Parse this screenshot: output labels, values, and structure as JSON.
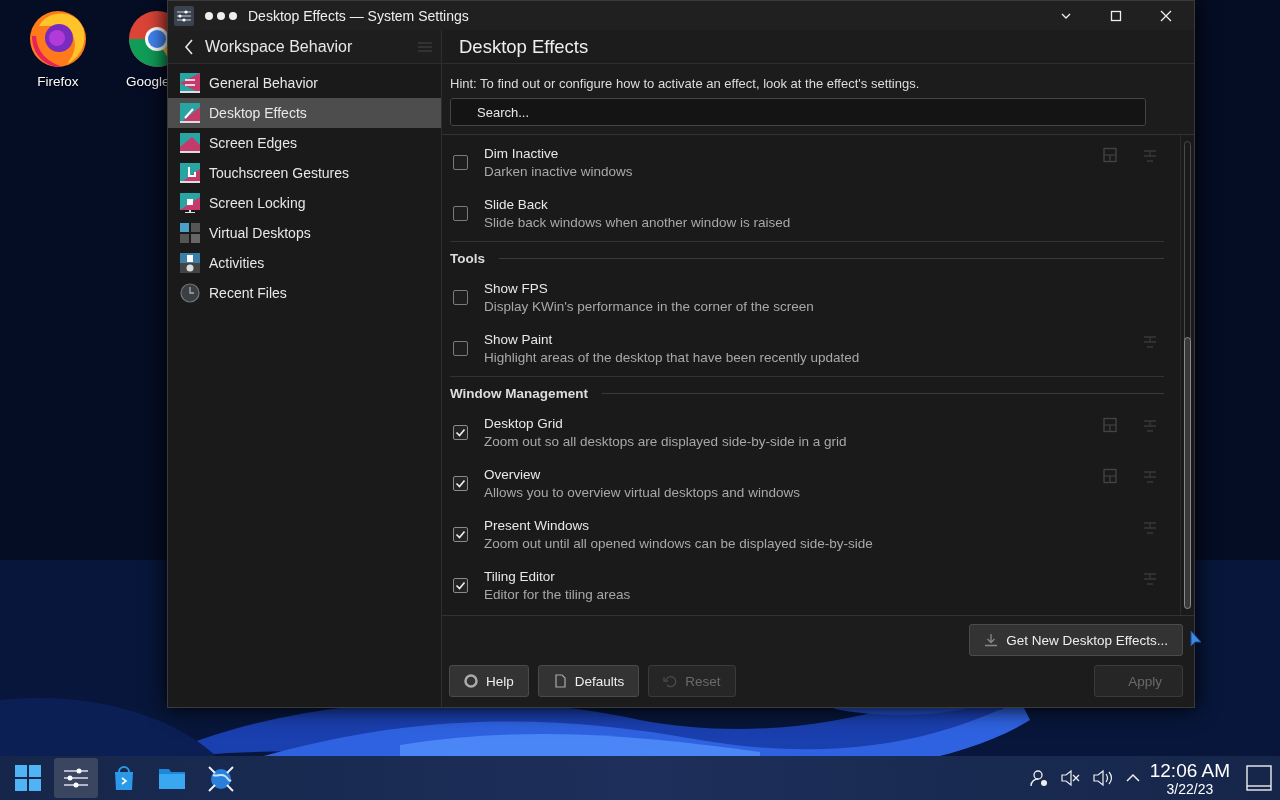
{
  "desktop_icons": [
    {
      "label": "Firefox",
      "kind": "firefox"
    },
    {
      "label": "Google",
      "kind": "chrome"
    }
  ],
  "window": {
    "title": "Desktop Effects — System Settings"
  },
  "sidebar": {
    "title": "Workspace Behavior",
    "items": [
      {
        "label": "General Behavior",
        "kind": "general",
        "selected": false
      },
      {
        "label": "Desktop Effects",
        "kind": "effects",
        "selected": true
      },
      {
        "label": "Screen Edges",
        "kind": "edges",
        "selected": false
      },
      {
        "label": "Touchscreen Gestures",
        "kind": "touch",
        "selected": false
      },
      {
        "label": "Screen Locking",
        "kind": "lock",
        "selected": false
      },
      {
        "label": "Virtual Desktops",
        "kind": "virtual",
        "selected": false
      },
      {
        "label": "Activities",
        "kind": "activities",
        "selected": false
      },
      {
        "label": "Recent Files",
        "kind": "recent",
        "selected": false
      }
    ]
  },
  "content": {
    "title": "Desktop Effects",
    "hint": "Hint: To find out or configure how to activate an effect, look at the effect's settings.",
    "search": {
      "placeholder": "Search..."
    },
    "sections": [
      {
        "effects": [
          {
            "name": "Dim Inactive",
            "description": "Darken inactive windows",
            "checked": false,
            "configurable": true,
            "video": true
          },
          {
            "name": "Slide Back",
            "description": "Slide back windows when another window is raised",
            "checked": false,
            "configurable": false,
            "video": false
          }
        ]
      },
      {
        "heading": "Tools",
        "effects": [
          {
            "name": "Show FPS",
            "description": "Display KWin's performance in the corner of the screen",
            "checked": false,
            "configurable": false,
            "video": false
          },
          {
            "name": "Show Paint",
            "description": "Highlight areas of the desktop that have been recently updated",
            "checked": false,
            "configurable": false,
            "video": true
          }
        ]
      },
      {
        "heading": "Window Management",
        "effects": [
          {
            "name": "Desktop Grid",
            "description": "Zoom out so all desktops are displayed side-by-side in a grid",
            "checked": true,
            "configurable": true,
            "video": true
          },
          {
            "name": "Overview",
            "description": "Allows you to overview virtual desktops and windows",
            "checked": true,
            "configurable": true,
            "video": true
          },
          {
            "name": "Present Windows",
            "description": "Zoom out until all opened windows can be displayed side-by-side",
            "checked": true,
            "configurable": false,
            "video": true
          },
          {
            "name": "Tiling Editor",
            "description": "Editor for the tiling areas",
            "checked": true,
            "configurable": false,
            "video": true
          }
        ]
      }
    ],
    "get_new": "Get New Desktop Effects..."
  },
  "buttons": [
    {
      "label": "Help",
      "kind": "help",
      "disabled": false
    },
    {
      "label": "Defaults",
      "kind": "defaults",
      "disabled": false
    },
    {
      "label": "Reset",
      "kind": "reset",
      "disabled": true
    },
    {
      "label": "Apply",
      "kind": "apply",
      "disabled": true
    }
  ],
  "taskbar": {
    "apps": [
      {
        "kind": "start",
        "active": false
      },
      {
        "kind": "settings",
        "active": true
      },
      {
        "kind": "store",
        "active": false
      },
      {
        "kind": "files",
        "active": false
      },
      {
        "kind": "globe",
        "active": false
      }
    ],
    "time": "12:06 AM",
    "date": "3/22/23"
  }
}
